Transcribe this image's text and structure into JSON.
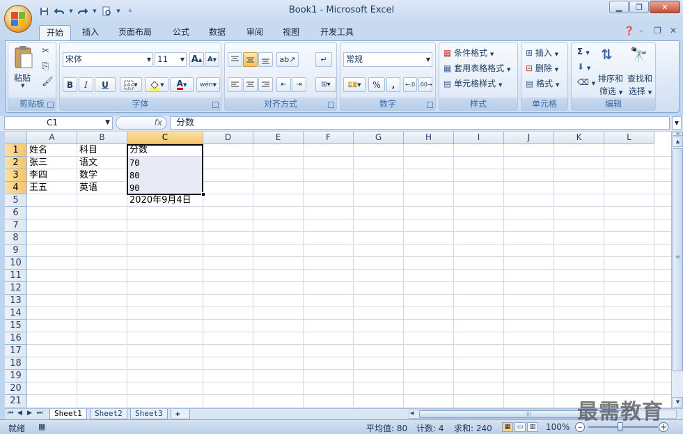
{
  "window": {
    "title": "Book1 - Microsoft Excel"
  },
  "qat": {
    "items": [
      "save-icon",
      "undo-icon",
      "redo-icon",
      "print-preview-icon",
      "customize-icon"
    ]
  },
  "tabs": [
    "开始",
    "插入",
    "页面布局",
    "公式",
    "数据",
    "审阅",
    "视图",
    "开发工具"
  ],
  "ribbon": {
    "clipboard": {
      "label": "剪贴板",
      "paste": "粘贴"
    },
    "font": {
      "label": "字体",
      "name": "宋体",
      "size": "11",
      "grow": "A",
      "shrink": "A",
      "bold": "B",
      "italic": "I",
      "underline": "U",
      "phonetic": "wén"
    },
    "alignment": {
      "label": "对齐方式"
    },
    "number": {
      "label": "数字",
      "format": "常规",
      "percent": "%",
      "comma": ","
    },
    "styles": {
      "label": "样式",
      "cond": "条件格式",
      "table": "套用表格格式",
      "cell": "单元格样式"
    },
    "cells": {
      "label": "单元格",
      "insert": "插入",
      "delete": "删除",
      "format": "格式"
    },
    "editing": {
      "label": "编辑",
      "sum": "Σ",
      "sort": "排序和",
      "sort2": "筛选",
      "find": "查找和",
      "find2": "选择"
    }
  },
  "formula_bar": {
    "name_box": "C1",
    "fx": "fx",
    "value": "分数"
  },
  "columns": [
    "A",
    "B",
    "C",
    "D",
    "E",
    "F",
    "G",
    "H",
    "I",
    "J",
    "K",
    "L"
  ],
  "rows": [
    "1",
    "2",
    "3",
    "4",
    "5",
    "6",
    "7",
    "8",
    "9",
    "10",
    "11",
    "12",
    "13",
    "14",
    "15",
    "16",
    "17",
    "18",
    "19",
    "20",
    "21"
  ],
  "cells": {
    "A1": "姓名",
    "B1": "科目",
    "C1": "分数",
    "A2": "张三",
    "B2": "语文",
    "C2": "70",
    "A3": "李四",
    "B3": "数学",
    "C3": "80",
    "A4": "王五",
    "B4": "英语",
    "C4": "90",
    "C5": "2020年9月4日"
  },
  "sheet_tabs": [
    "Sheet1",
    "Sheet2",
    "Sheet3"
  ],
  "status": {
    "ready": "就绪",
    "average": "平均值: 80",
    "count": "计数: 4",
    "sum": "求和: 240",
    "zoom": "100%"
  },
  "watermark": "最需教育",
  "colors": {
    "accent": "#f5c46b",
    "ribbon": "#dde8f6",
    "grid": "#d0d7e5"
  }
}
